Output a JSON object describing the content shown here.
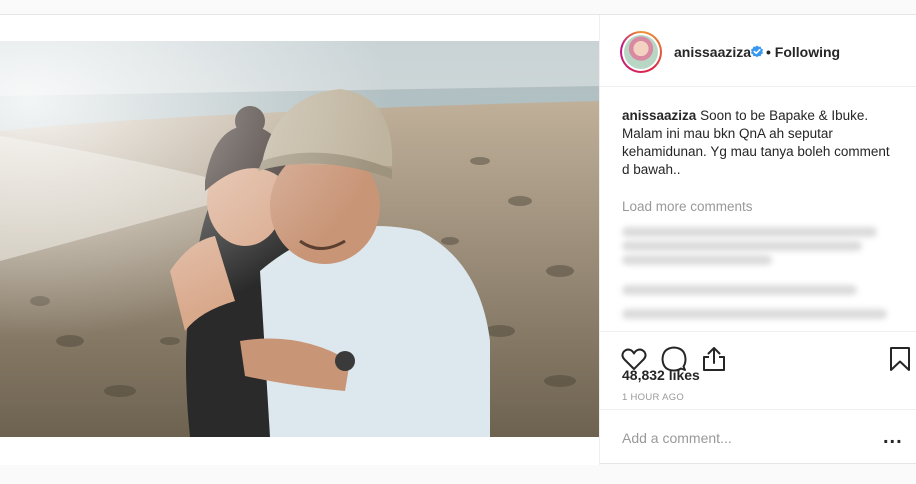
{
  "post": {
    "username": "anissaaziza",
    "follow_status": "• Following",
    "caption_username": "anissaaziza",
    "caption_text": "Soon to be Bapake & Ibuke. Malam ini mau bkn QnA ah seputar kehamidunan. Yg mau tanya boleh comment d bawah..",
    "load_more": "Load more comments",
    "likes": "48,832 likes",
    "timestamp": "1 HOUR AGO",
    "comment_placeholder": "Add a comment...",
    "more_options": "..."
  },
  "icons": {
    "like": "heart-icon",
    "comment": "comment-bubble-icon",
    "share": "share-icon",
    "save": "bookmark-icon",
    "verified": "verified-badge-icon"
  },
  "colors": {
    "verified": "#3897f0",
    "text": "#262626",
    "muted": "#999999",
    "border": "#efefef"
  }
}
